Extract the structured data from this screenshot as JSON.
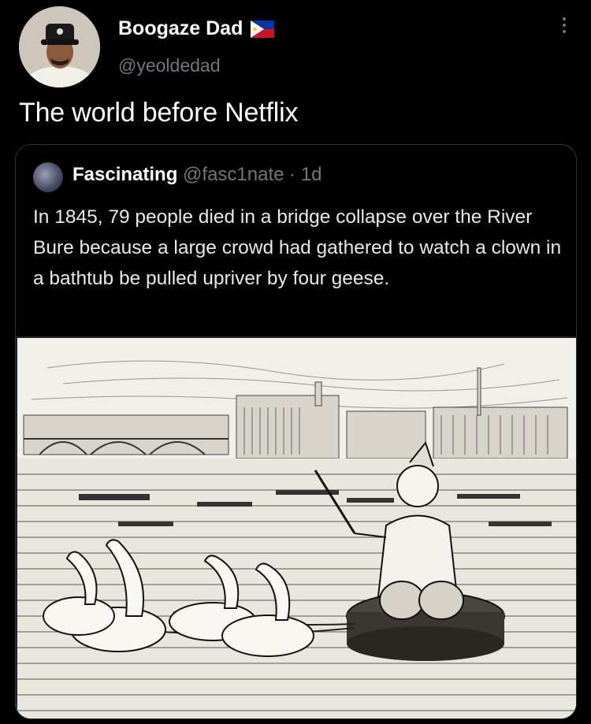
{
  "tweet": {
    "author": {
      "display_name": "Boogaze Dad",
      "handle": "@yeoldedad",
      "avatar_icon": "avatar-man-hat",
      "flag_icon": "philippines-flag-icon"
    },
    "text": "The world before Netflix",
    "more_icon": "more-vertical-icon"
  },
  "quoted_tweet": {
    "display_name": "Fascinating",
    "handle": "@fasc1nate",
    "separator": "·",
    "time": "1d",
    "text": "In 1845, 79 people died in a bridge collapse over the River Bure because a large crowd had gathered to watch a clown in a bathtub be pulled upriver by four geese.",
    "image": "engraving of a clown in a bathtub pulled by four geese on a river"
  },
  "colors": {
    "background": "#000000",
    "primary_text": "#e7e9ea",
    "secondary_text": "#71767b",
    "border": "#2f3336"
  }
}
